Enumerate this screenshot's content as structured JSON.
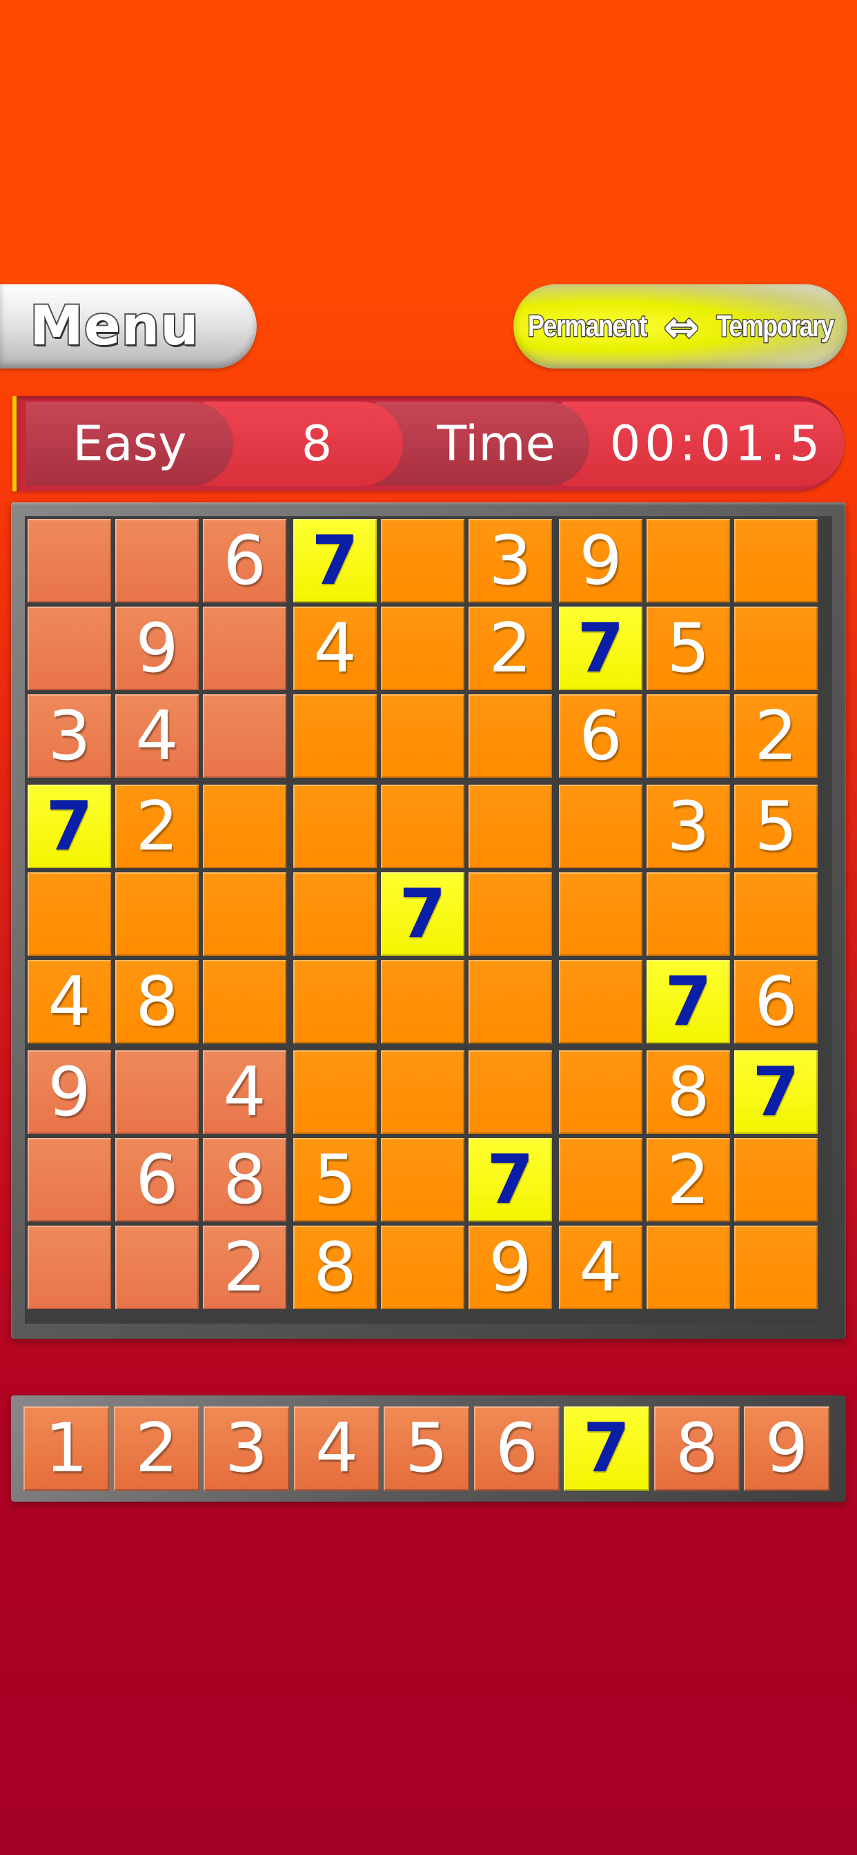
{
  "header": {
    "menu_label": "Menu",
    "mode_left": "Permanent",
    "mode_arrow": "⇔",
    "mode_right": "Temporary"
  },
  "status": {
    "difficulty": "Easy",
    "puzzle_number": "8",
    "time_label": "Time",
    "time_value": "00:01.5"
  },
  "colors": {
    "highlight": "#f4f400",
    "highlight_digit": "#0a1ea8",
    "cell_orange": "#ff8c00",
    "cell_salmon": "#e9744a"
  },
  "selected_number": "7",
  "board": {
    "rows": [
      [
        "",
        "",
        "6",
        "7",
        "",
        "3",
        "9",
        "",
        ""
      ],
      [
        "",
        "9",
        "",
        "4",
        "",
        "2",
        "7",
        "5",
        ""
      ],
      [
        "3",
        "4",
        "",
        "",
        "",
        "",
        "6",
        "",
        "2"
      ],
      [
        "7",
        "2",
        "",
        "",
        "",
        "",
        "",
        "3",
        "5"
      ],
      [
        "",
        "",
        "",
        "",
        "7",
        "",
        "",
        "",
        ""
      ],
      [
        "4",
        "8",
        "",
        "",
        "",
        "",
        "",
        "7",
        "6"
      ],
      [
        "9",
        "",
        "4",
        "",
        "",
        "",
        "",
        "8",
        "7"
      ],
      [
        "",
        "6",
        "8",
        "5",
        "",
        "7",
        "",
        "2",
        ""
      ],
      [
        "",
        "",
        "2",
        "8",
        "",
        "9",
        "4",
        "",
        ""
      ]
    ],
    "salmon_cells": [
      [
        0,
        0
      ],
      [
        0,
        1
      ],
      [
        0,
        2
      ],
      [
        1,
        0
      ],
      [
        1,
        1
      ],
      [
        1,
        2
      ],
      [
        2,
        0
      ],
      [
        2,
        1
      ],
      [
        2,
        2
      ],
      [
        6,
        0
      ],
      [
        6,
        1
      ],
      [
        6,
        2
      ],
      [
        7,
        0
      ],
      [
        7,
        1
      ],
      [
        7,
        2
      ],
      [
        8,
        0
      ],
      [
        8,
        1
      ],
      [
        8,
        2
      ]
    ]
  },
  "number_pad": [
    "1",
    "2",
    "3",
    "4",
    "5",
    "6",
    "7",
    "8",
    "9"
  ]
}
